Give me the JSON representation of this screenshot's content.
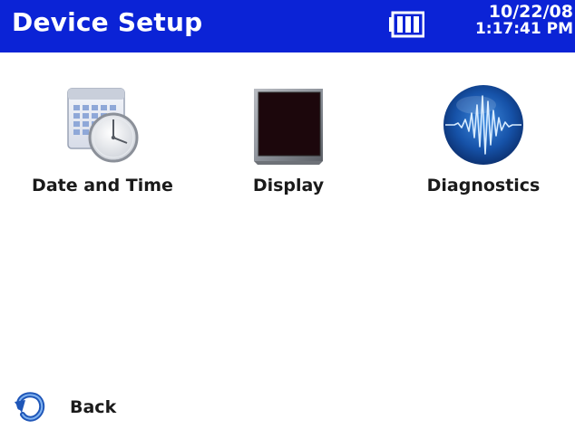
{
  "header": {
    "title": "Device Setup",
    "date": "10/22/08",
    "time": "1:17:41 PM",
    "battery_icon": "battery-icon",
    "background_color": "#0b23d6"
  },
  "items": [
    {
      "label": "Date and Time",
      "icon": "calendar-clock-icon"
    },
    {
      "label": "Display",
      "icon": "monitor-icon"
    },
    {
      "label": "Diagnostics",
      "icon": "waveform-globe-icon"
    }
  ],
  "footer": {
    "back_label": "Back",
    "back_icon": "back-arrow-icon"
  }
}
